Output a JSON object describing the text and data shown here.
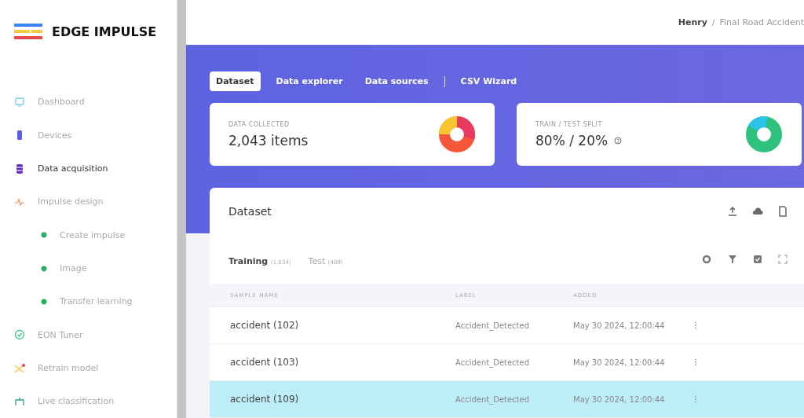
{
  "brand": {
    "name": "EDGE IMPULSE"
  },
  "sidebar": {
    "items": [
      {
        "kind": "item",
        "label": "Dashboard",
        "selected": false
      },
      {
        "kind": "item",
        "label": "Devices",
        "selected": false
      },
      {
        "kind": "item",
        "label": "Data acquisition",
        "selected": true
      },
      {
        "kind": "item",
        "label": "Impulse design",
        "selected": false
      },
      {
        "kind": "subitem",
        "label": "Create impulse",
        "selected": false
      },
      {
        "kind": "subitem",
        "label": "Image",
        "selected": false
      },
      {
        "kind": "subitem",
        "label": "Transfer learning",
        "selected": false
      },
      {
        "kind": "item",
        "label": "EON Tuner",
        "selected": false
      },
      {
        "kind": "item",
        "label": "Retrain model",
        "selected": false
      },
      {
        "kind": "item",
        "label": "Live classification",
        "selected": false
      }
    ]
  },
  "breadcrumb": {
    "user": "Henry",
    "separator": "/",
    "project": "Final Road Accident"
  },
  "tabs": [
    {
      "label": "Dataset",
      "selected": true
    },
    {
      "label": "Data explorer",
      "selected": false
    },
    {
      "label": "Data sources",
      "selected": false
    },
    {
      "label": "CSV Wizard",
      "selected": false
    }
  ],
  "stats": [
    {
      "label": "DATA COLLECTED",
      "value": "2,043 items",
      "help": false
    },
    {
      "label": "TRAIN / TEST SPLIT",
      "value": "80% / 20%",
      "help": true
    }
  ],
  "dataset": {
    "title": "Dataset",
    "subtabs": [
      {
        "label": "Training",
        "count": "(1,634)",
        "selected": true
      },
      {
        "label": "Test",
        "count": "(409)",
        "selected": false
      }
    ],
    "columns": [
      "SAMPLE NAME",
      "LABEL",
      "ADDED"
    ],
    "rows": [
      {
        "name": "accident (102)",
        "label": "Accident_Detected",
        "added": "May 30 2024, 12:00:44",
        "selected": false
      },
      {
        "name": "accident (103)",
        "label": "Accident_Detected",
        "added": "May 30 2024, 12:00:44",
        "selected": false
      },
      {
        "name": "accident (109)",
        "label": "Accident_Detected",
        "added": "May 30 2024, 12:00:44",
        "selected": true
      }
    ]
  }
}
